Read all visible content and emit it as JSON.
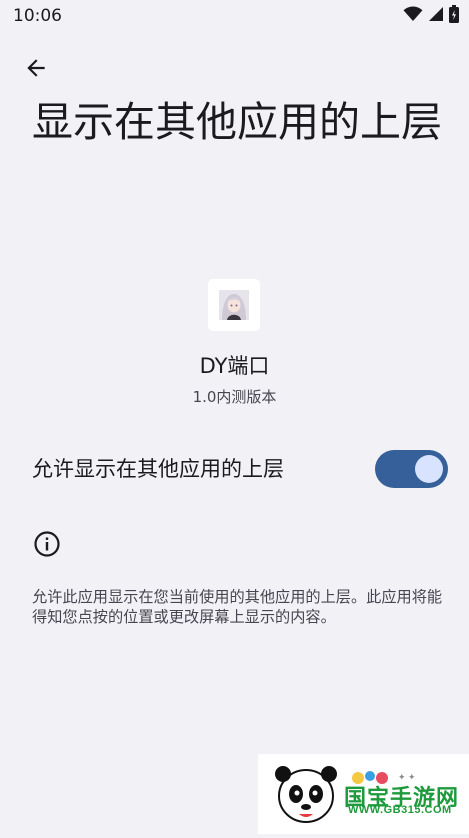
{
  "status_bar": {
    "time": "10:06",
    "icons": [
      "wifi-icon",
      "cell-signal-icon",
      "battery-icon"
    ]
  },
  "header": {
    "back_icon": "arrow-back-icon",
    "title": "显示在其他应用的上层"
  },
  "app": {
    "name": "DY端口",
    "version": "1.0内测版本",
    "icon": "app-avatar-icon"
  },
  "permission": {
    "label": "允许显示在其他应用的上层",
    "enabled": true
  },
  "info": {
    "icon": "info-icon",
    "description": "允许此应用显示在您当前使用的其他应用的上层。此应用将能得知您点按的位置或更改屏幕上显示的内容。"
  },
  "watermark": {
    "brand": "国宝手游网",
    "site": "WWW.GB315.COM"
  },
  "colors": {
    "background": "#f2f1f6",
    "toggle_track": "#36609a",
    "toggle_thumb": "#d7e3ff",
    "watermark_green": "#1e9a3c"
  }
}
